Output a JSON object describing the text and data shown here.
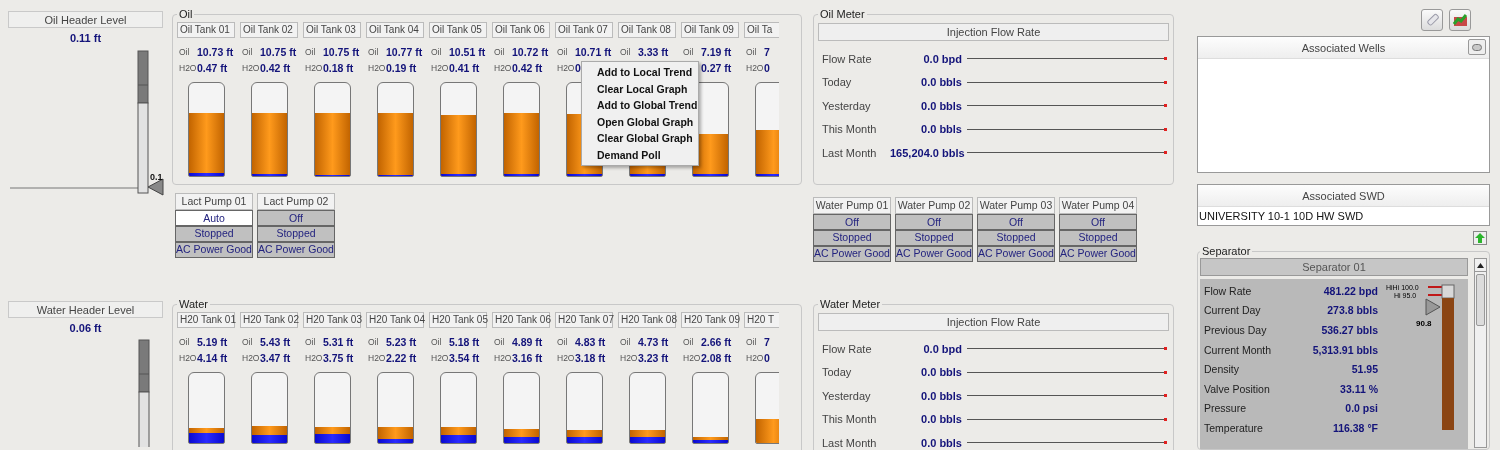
{
  "sections": [
    {
      "header": {
        "title": "Oil Header Level",
        "value": "0.11 ft",
        "marker": "0.1"
      },
      "group": {
        "title": "Oil",
        "tanks": [
          {
            "label": "Oil Tank 01",
            "readings": [
              {
                "label": "Oil",
                "value": "10.73 ft"
              },
              {
                "label": "H2O",
                "value": "0.47 ft"
              }
            ],
            "oil": {
              "level": 0.68
            },
            "water": {
              "level": 0.03
            }
          },
          {
            "label": "Oil Tank 02",
            "readings": [
              {
                "label": "Oil",
                "value": "10.75 ft"
              },
              {
                "label": "H2O",
                "value": "0.42 ft"
              }
            ],
            "oil": {
              "level": 0.68
            },
            "water": {
              "level": 0.025
            }
          },
          {
            "label": "Oil Tank 03",
            "readings": [
              {
                "label": "Oil",
                "value": "10.75 ft"
              },
              {
                "label": "H2O",
                "value": "0.18 ft"
              }
            ],
            "oil": {
              "level": 0.68
            },
            "water": {
              "level": 0.012
            }
          },
          {
            "label": "Oil Tank 04",
            "readings": [
              {
                "label": "Oil",
                "value": "10.77 ft"
              },
              {
                "label": "H2O",
                "value": "0.19 ft"
              }
            ],
            "oil": {
              "level": 0.68
            },
            "water": {
              "level": 0.012
            }
          },
          {
            "label": "Oil Tank 05",
            "readings": [
              {
                "label": "Oil",
                "value": "10.51 ft"
              },
              {
                "label": "H2O",
                "value": "0.41 ft"
              }
            ],
            "oil": {
              "level": 0.66
            },
            "water": {
              "level": 0.025
            }
          },
          {
            "label": "Oil Tank 06",
            "readings": [
              {
                "label": "Oil",
                "value": "10.72 ft"
              },
              {
                "label": "H2O",
                "value": "0.42 ft"
              }
            ],
            "oil": {
              "level": 0.68
            },
            "water": {
              "level": 0.025
            }
          },
          {
            "label": "Oil Tank 07",
            "readings": [
              {
                "label": "Oil",
                "value": "10.71 ft"
              },
              {
                "label": "H2O",
                "value": "0."
              }
            ],
            "oil": {
              "level": 0.67
            },
            "water": {
              "level": 0.025
            }
          },
          {
            "label": "Oil Tank 08",
            "readings": [
              {
                "label": "Oil",
                "value": "3.33 ft"
              }
            ],
            "oil": {
              "level": 0.22
            },
            "water": {
              "level": 0.02
            }
          },
          {
            "label": "Oil Tank 09",
            "readings": [
              {
                "label": "Oil",
                "value": "7.19 ft"
              },
              {
                "value": "0.27 ft"
              }
            ],
            "oil": {
              "level": 0.45
            },
            "water": {
              "level": 0.02
            }
          },
          {
            "label": "Oil Ta",
            "readings": [
              {
                "label": "Oil",
                "value": "7"
              },
              {
                "label": "H2O",
                "value": "0"
              }
            ],
            "oil": {
              "level": 0.5
            },
            "water": {
              "level": 0.02
            }
          }
        ],
        "context_menu": {
          "items": [
            "Add to Local Trend",
            "Clear Local Graph",
            "Add to Global Trend",
            "Open Global Graph",
            "Clear Global Graph",
            "Demand Poll"
          ]
        }
      },
      "lact_pumps": [
        {
          "title": "Lact Pump 01",
          "mode": "Auto",
          "auto": true,
          "status": "Stopped",
          "power": "AC Power Good"
        },
        {
          "title": "Lact Pump 02",
          "mode": "Off",
          "auto": false,
          "status": "Stopped",
          "power": "AC Power Good"
        }
      ],
      "meter": {
        "title": "Oil Meter",
        "header": "Injection Flow Rate",
        "rows": [
          {
            "label": "Flow Rate",
            "value": "0.0 bpd"
          },
          {
            "label": "Today",
            "value": "0.0 bbls"
          },
          {
            "label": "Yesterday",
            "value": "0.0 bbls"
          },
          {
            "label": "This Month",
            "value": "0.0 bbls"
          },
          {
            "label": "Last Month",
            "value": "165,204.0 bbls"
          }
        ]
      },
      "meter_pumps": [
        {
          "title": "Water Pump 01",
          "mode": "Off",
          "auto": false,
          "status": "Stopped",
          "power": "AC Power Good"
        },
        {
          "title": "Water Pump 02",
          "mode": "Off",
          "auto": false,
          "status": "Stopped",
          "power": "AC Power Good"
        },
        {
          "title": "Water Pump 03",
          "mode": "Off",
          "auto": false,
          "status": "Stopped",
          "power": "AC Power Good"
        },
        {
          "title": "Water Pump 04",
          "mode": "Off",
          "auto": false,
          "status": "Stopped",
          "power": "AC Power Good"
        }
      ]
    },
    {
      "header": {
        "title": "Water Header Level",
        "value": "0.06 ft"
      },
      "group": {
        "title": "Water",
        "tanks": [
          {
            "label": "H20 Tank 01",
            "readings": [
              {
                "label": "Oil",
                "value": "5.19 ft"
              },
              {
                "label": "H2O",
                "value": "4.14 ft"
              }
            ],
            "oil": {
              "level": 0.22
            },
            "water": {
              "level": 0.14
            }
          },
          {
            "label": "H20 Tank 02",
            "readings": [
              {
                "label": "Oil",
                "value": "5.43 ft"
              },
              {
                "label": "H2O",
                "value": "3.47 ft"
              }
            ],
            "oil": {
              "level": 0.24
            },
            "water": {
              "level": 0.11
            }
          },
          {
            "label": "H20 Tank 03",
            "readings": [
              {
                "label": "Oil",
                "value": "5.31 ft"
              },
              {
                "label": "H2O",
                "value": "3.75 ft"
              }
            ],
            "oil": {
              "level": 0.23
            },
            "water": {
              "level": 0.13
            }
          },
          {
            "label": "H20 Tank 04",
            "readings": [
              {
                "label": "Oil",
                "value": "5.23 ft"
              },
              {
                "label": "H2O",
                "value": "2.22 ft"
              }
            ],
            "oil": {
              "level": 0.23
            },
            "water": {
              "level": 0.06
            }
          },
          {
            "label": "H20 Tank 05",
            "readings": [
              {
                "label": "Oil",
                "value": "5.18 ft"
              },
              {
                "label": "H2O",
                "value": "3.54 ft"
              }
            ],
            "oil": {
              "level": 0.23
            },
            "water": {
              "level": 0.11
            }
          },
          {
            "label": "H20 Tank 06",
            "readings": [
              {
                "label": "Oil",
                "value": "4.89 ft"
              },
              {
                "label": "H2O",
                "value": "3.16 ft"
              }
            ],
            "oil": {
              "level": 0.2
            },
            "water": {
              "level": 0.08
            }
          },
          {
            "label": "H20 Tank 07",
            "readings": [
              {
                "label": "Oil",
                "value": "4.83 ft"
              },
              {
                "label": "H2O",
                "value": "3.18 ft"
              }
            ],
            "oil": {
              "level": 0.19
            },
            "water": {
              "level": 0.08
            }
          },
          {
            "label": "H20 Tank 08",
            "readings": [
              {
                "label": "Oil",
                "value": "4.73 ft"
              },
              {
                "label": "H2O",
                "value": "3.23 ft"
              }
            ],
            "oil": {
              "level": 0.19
            },
            "water": {
              "level": 0.08
            }
          },
          {
            "label": "H20 Tank 09",
            "readings": [
              {
                "label": "Oil",
                "value": "2.66 ft"
              },
              {
                "label": "H2O",
                "value": "2.08 ft"
              }
            ],
            "oil": {
              "level": 0.09
            },
            "water": {
              "level": 0.05
            }
          },
          {
            "label": "H20 T",
            "readings": [
              {
                "label": "Oil",
                "value": "7"
              },
              {
                "label": "H2O",
                "value": "0"
              }
            ],
            "oil": {
              "level": 0.35
            }
          }
        ]
      },
      "meter": {
        "title": "Water Meter",
        "header": "Injection Flow Rate",
        "rows": [
          {
            "label": "Flow Rate",
            "value": "0.0 bpd"
          },
          {
            "label": "Today",
            "value": "0.0 bbls"
          },
          {
            "label": "Yesterday",
            "value": "0.0 bbls"
          },
          {
            "label": "This Month",
            "value": "0.0 bbls"
          },
          {
            "label": "Last Month",
            "value": "0.0 bbls"
          }
        ]
      }
    }
  ],
  "associated_wells": {
    "title": "Associated Wells"
  },
  "associated_swd": {
    "title": "Associated SWD",
    "rows": [
      "UNIVERSITY 10-1 10D HW SWD"
    ]
  },
  "separator": {
    "title": "Separator",
    "name": "Separator 01",
    "rows": [
      {
        "label": "Flow Rate",
        "value": "481.22 bpd"
      },
      {
        "label": "Current Day",
        "value": "273.8 bbls"
      },
      {
        "label": "Previous Day",
        "value": "536.27 bbls"
      },
      {
        "label": "Current Month",
        "value": "5,313.91 bbls"
      },
      {
        "label": "Density",
        "value": "51.95"
      },
      {
        "label": "Valve Position",
        "value": "33.11 %"
      },
      {
        "label": "Pressure",
        "value": "0.0 psi"
      },
      {
        "label": "Temperature",
        "value": "116.38 °F"
      }
    ],
    "gauge": {
      "hihi": "HiHi 100.0",
      "hi": "Hi 95.0",
      "value": "90.8",
      "level": 0.91
    }
  }
}
